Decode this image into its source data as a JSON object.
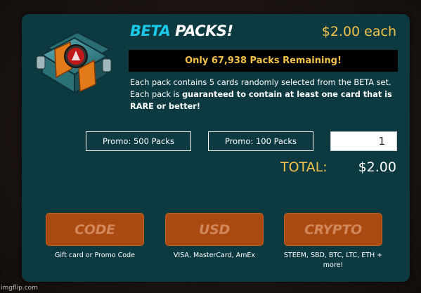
{
  "header": {
    "title_highlight": "BETA",
    "title_rest": " PACKS!",
    "price": "$2.00 each"
  },
  "remaining_banner": "Only 67,938 Packs Remaining!",
  "description": {
    "plain": "Each pack contains 5 cards randomly selected from the BETA set. Each pack is ",
    "bold": "guaranteed to contain at least one card that is RARE or better!"
  },
  "promos": {
    "promo_500": "Promo: 500 Packs",
    "promo_100": "Promo: 100 Packs"
  },
  "quantity": {
    "value": "1"
  },
  "total": {
    "label": "TOTAL:",
    "value": "$2.00"
  },
  "payment": {
    "code": {
      "label": "CODE",
      "sub": "Gift card or Promo Code"
    },
    "usd": {
      "label": "USD",
      "sub": "VISA, MasterCard, AmEx"
    },
    "crypto": {
      "label": "CRYPTO",
      "sub": "STEEM, SBD, BTC, LTC, ETH + more!"
    }
  },
  "watermark": "imgflip.com",
  "colors": {
    "card_bg": "#0c3a40",
    "accent_gold": "#f2c34a",
    "accent_cyan": "#1cc8e8",
    "button_orange": "#a94a12",
    "button_text": "#d2875a"
  },
  "icons": {
    "pack": "card-pack-icon"
  }
}
